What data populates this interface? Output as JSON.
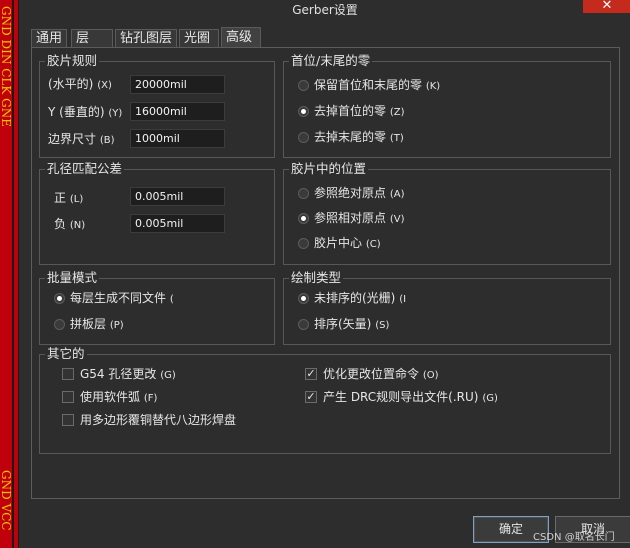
{
  "window": {
    "title": "Gerber设置",
    "close_glyph": "✕"
  },
  "background_strip": {
    "text_top": "GND DIN CLK GNE",
    "text_bottom": "GND VCC",
    "colors": {
      "red": "#c0000a",
      "yellow": "#f2c400"
    }
  },
  "tabs": [
    {
      "label": "通用"
    },
    {
      "label": "层"
    },
    {
      "label": "钻孔图层"
    },
    {
      "label": "光圈"
    },
    {
      "label": "高级"
    }
  ],
  "active_tab": "高级",
  "film_rules": {
    "title": "胶片规则",
    "rows": [
      {
        "label": "(水平的)",
        "key": "(X)",
        "value": "20000mil"
      },
      {
        "label": "Y (垂直的)",
        "key": "(Y)",
        "value": "16000mil"
      },
      {
        "label": "边界尺寸",
        "key": "(B)",
        "value": "1000mil"
      }
    ]
  },
  "zeros": {
    "title": "首位/末尾的零",
    "options": [
      {
        "label": "保留首位和末尾的零",
        "key": "(K)",
        "selected": false
      },
      {
        "label": "去掉首位的零",
        "key": "(Z)",
        "selected": true
      },
      {
        "label": "去掉末尾的零",
        "key": "(T)",
        "selected": false
      }
    ]
  },
  "tolerance": {
    "title": "孔径匹配公差",
    "rows": [
      {
        "label": "正",
        "key": "(L)",
        "value": "0.005mil"
      },
      {
        "label": "负",
        "key": "(N)",
        "value": "0.005mil"
      }
    ]
  },
  "film_position": {
    "title": "胶片中的位置",
    "options": [
      {
        "label": "参照绝对原点",
        "key": "(A)",
        "selected": false
      },
      {
        "label": "参照相对原点",
        "key": "(V)",
        "selected": true
      },
      {
        "label": "胶片中心",
        "key": "(C)",
        "selected": false
      }
    ]
  },
  "batch_mode": {
    "title": "批量模式",
    "options": [
      {
        "label": "每层生成不同文件",
        "key": "(",
        "selected": true
      },
      {
        "label": "拼板层",
        "key": "(P)",
        "selected": false
      }
    ]
  },
  "plot_type": {
    "title": "绘制类型",
    "options": [
      {
        "label": "未排序的(光栅)",
        "key": "(I",
        "selected": true
      },
      {
        "label": "排序(矢量)",
        "key": "(S)",
        "selected": false
      }
    ]
  },
  "other": {
    "title": "其它的",
    "left": [
      {
        "label": "G54 孔径更改",
        "key": "(G)",
        "checked": false
      },
      {
        "label": "使用软件弧",
        "key": "(F)",
        "checked": false
      },
      {
        "label": "用多边形覆铜替代八边形焊盘",
        "key": "",
        "checked": false
      }
    ],
    "right": [
      {
        "label": "优化更改位置命令",
        "key": "(O)",
        "checked": true
      },
      {
        "label": "产生 DRC规则导出文件(.RU)",
        "key": "(G)",
        "checked": true
      }
    ]
  },
  "buttons": {
    "ok": "确定",
    "cancel": "取消"
  },
  "watermark": "CSDN @取名长门",
  "check_glyph": "✓"
}
